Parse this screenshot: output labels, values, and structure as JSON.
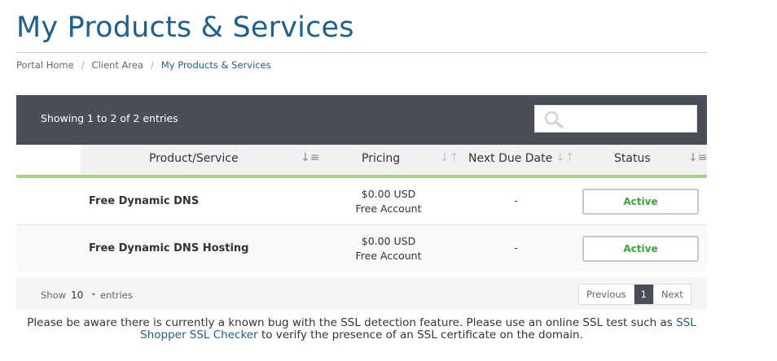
{
  "page": {
    "title": "My Products & Services"
  },
  "breadcrumb": {
    "items": [
      {
        "label": "Portal Home"
      },
      {
        "label": "Client Area"
      },
      {
        "label": "My Products & Services"
      }
    ],
    "separator": "/"
  },
  "table": {
    "showing_text": "Showing 1 to 2 of 2 entries",
    "search": {
      "placeholder": "",
      "value": "",
      "icon": "search-icon"
    },
    "columns": [
      {
        "label": "Product/Service",
        "sort": "sorted-desc"
      },
      {
        "label": "Pricing",
        "sort": "unsorted"
      },
      {
        "label": "Next Due Date",
        "sort": "unsorted"
      },
      {
        "label": "Status",
        "sort": "sorted-desc"
      }
    ],
    "rows": [
      {
        "product": "Free Dynamic DNS",
        "price": "$0.00 USD",
        "billing": "Free Account",
        "next_due": "-",
        "status": "Active"
      },
      {
        "product": "Free Dynamic DNS Hosting",
        "price": "$0.00 USD",
        "billing": "Free Account",
        "next_due": "-",
        "status": "Active"
      }
    ],
    "footer": {
      "show_label": "Show",
      "page_length": "10",
      "entries_label": "entries",
      "pagination": {
        "previous": "Previous",
        "current": "1",
        "next": "Next"
      }
    }
  },
  "notice": {
    "text_before": "Please be aware there is currently a known bug with the SSL detection feature. Please use an online SSL test such as ",
    "link": "SSL Shopper SSL Checker",
    "text_after": " to verify the presence of an SSL certificate on the domain."
  },
  "colors": {
    "title": "#1f5f8b",
    "header_bar": "#4a4e57",
    "active_green": "#3ba53b",
    "sort_underline": "#6fb53f",
    "header_line": "#a6d48b"
  }
}
